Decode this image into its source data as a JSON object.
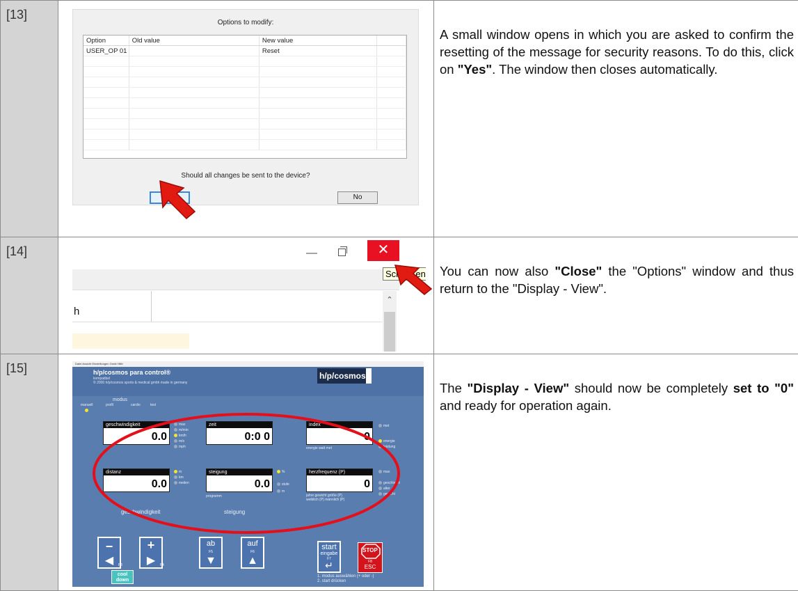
{
  "steps": [
    {
      "num": "[13]",
      "text_parts": [
        "A small window opens in which you are asked to confirm the resetting of the message for security reasons. To do this, click on ",
        "\"Yes\"",
        ". The window then closes automatically."
      ],
      "dialog": {
        "title": "Options to modify:",
        "columns": [
          "Option",
          "Old value",
          "New value",
          ""
        ],
        "rows": [
          [
            "USER_OP 01",
            "",
            "Reset"
          ]
        ],
        "question": "Should all changes be sent to the device?",
        "yes_label": "Yes",
        "no_label": "No"
      }
    },
    {
      "num": "[14]",
      "text_parts": [
        "You can now also ",
        "\"Close\"",
        " the \"Options\" window and thus return to the \"Display - View\"."
      ],
      "window": {
        "tooltip": "Schließen",
        "close_glyph": "✕",
        "minimize_glyph": "—",
        "partial_text": "h"
      }
    },
    {
      "num": "[15]",
      "text_parts": [
        "The ",
        "\"Display - View\"",
        " should now be completely ",
        "set to \"0\"",
        " and ready for operation again."
      ],
      "panel": {
        "menu": "Datei  Ansicht  Einstellungen  Gerät  Hilfe",
        "brand": "h/p/cosmos para control®",
        "subtitle": "kompatibel",
        "copyright": "© 2000 h/p/cosmos sports & medical gmbh    made in germany",
        "logo": "h/p/cosmos",
        "modus": "modus",
        "modes": [
          "manuell",
          "profil",
          "cardio",
          "test"
        ],
        "displays": [
          {
            "label": "geschwindigkeit",
            "value": "0.0"
          },
          {
            "label": "zeit",
            "value": "0:0 0"
          },
          {
            "label": "index",
            "value": "0"
          },
          {
            "label": "distanz",
            "value": "0.0"
          },
          {
            "label": "steigung",
            "value": "0.0"
          },
          {
            "label": "herzfrequenz (P)",
            "value": "0"
          }
        ],
        "speed_units": [
          "max",
          "m/min",
          "km/h",
          "m/s",
          "mph"
        ],
        "dist_units": [
          "m",
          "km",
          "meilen"
        ],
        "grade_units": [
          "%",
          "stufe",
          "m"
        ],
        "index_sub": "energie   watt   met",
        "hr_sub": "jahre   gewicht   größe (P)",
        "hr_sub2": "weiblich (P)  männlich (P)",
        "right_units": [
          "met",
          "energie",
          "leistung",
          "max",
          "geschlecht",
          "alter",
          "gewicht"
        ],
        "programm": "programm",
        "geschwindigkeit_label": "geschwindigkeit",
        "steigung_label": "steigung",
        "ab": "ab",
        "auf": "auf",
        "f3": "F3",
        "f4": "F4",
        "f5": "F5",
        "f6": "F6",
        "start": "start",
        "eingabe": "eingabe",
        "f7": "F7",
        "stop": "STOP",
        "f8": "F8",
        "esc": "ESC",
        "cool": "cool",
        "down": "down",
        "hint1": "1. modus auswählen (+ oder -)",
        "hint2": "2. start drücken"
      }
    }
  ],
  "colors": {
    "arrow": "#e21b12",
    "ellipse": "#e3101c",
    "panel": "#5a7db0",
    "close": "#e81123"
  }
}
